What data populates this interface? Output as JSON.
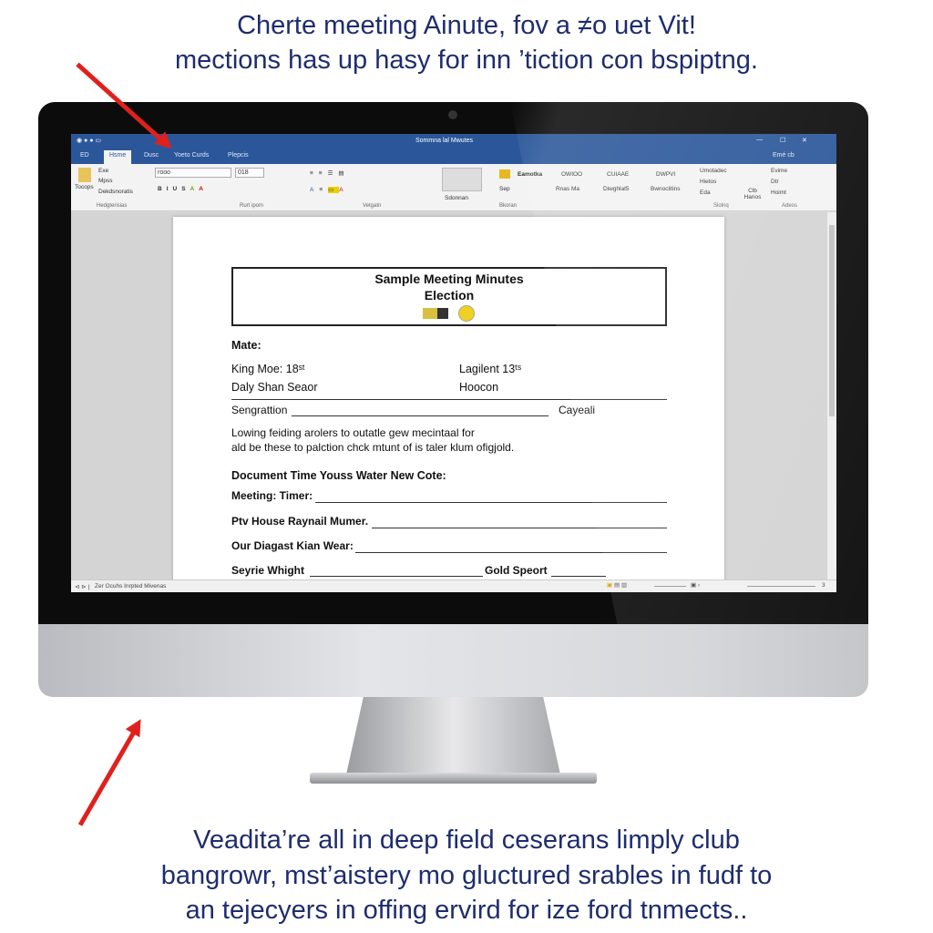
{
  "captions": {
    "top": [
      "Cherte meeting Ainute, fov a ≠o uet Vit!",
      "mections has up hasy for inn ’tiction con bspiptng."
    ],
    "bottom": [
      "Veadita’re all in deep field ceserans limply club",
      "bangrowr, mst’aistery mo gluctured srables in fudf to",
      "an tejecyers in offing ervird for ize ford tnmects.."
    ]
  },
  "accent_color": "#2b579a",
  "arrow_color": "#e0201c",
  "word": {
    "window_title": "Sommna lal Mwutes",
    "window_controls": [
      "—",
      "☐",
      "✕"
    ],
    "user": "Emé cb",
    "tabs": [
      {
        "label": "ED",
        "active": false
      },
      {
        "label": "Hsme",
        "active": true
      },
      {
        "label": "Dusc",
        "active": false
      },
      {
        "label": "Yoeto Curds",
        "active": false
      },
      {
        "label": "Plepcis",
        "active": false
      }
    ],
    "ribbon": {
      "clipboard": {
        "paste": "Tocops",
        "items": [
          "Exe",
          "Mpss",
          "Dekdsnoratis"
        ],
        "label": "Hedgterisias"
      },
      "font": {
        "font_name": "rooo",
        "font_size": "018",
        "label": "Rurt ipom"
      },
      "paragraph": {
        "label": "Vetgatn"
      },
      "styles": {
        "items": [
          "Eamotka",
          "OWIOO",
          "CUIAAE",
          "DWPVI"
        ],
        "subitems": [
          "Sep",
          "Rnas Ma",
          "Diwghlat5",
          "Bwnoclitins"
        ],
        "label": "Bkoran",
        "gallery_caption": "Sdonnan"
      },
      "editing": {
        "items": [
          "Umotadec",
          "Hietos",
          "Eda"
        ],
        "label": "Slolnq"
      },
      "large_button": "Clb Hanos",
      "right": {
        "items": [
          "Evime",
          "Dtr",
          "Hoimt"
        ],
        "label": "Adeos"
      }
    },
    "document": {
      "title": "Sample Meeting Minutes",
      "subtitle": "Election",
      "rows": {
        "mate": "Mate:",
        "king": "King Moe: 18ˢᵗ",
        "lagilent": "Lagilent 13ᵗˢ",
        "daly": "Daly Shan Seaor",
        "hoocon": "Hoocon",
        "sengrattion": "Sengrattion",
        "cayeali": "Cayeali",
        "para1": "Lowing feiding arolers to outatle gew mecintaal for",
        "para2": "ald be these to palction chck mtunt of is taler klum ofigjold.",
        "doc_time": "Document Time Youss Water New Cote:",
        "meeting_timer": "Meeting: Timer:",
        "ptv_house": "Ptv House Raynail Mumer.",
        "our_diagast": "Our Diagast Kian Wear:",
        "seyrie": "Seyrie Whight",
        "gold": "Gold Speort"
      }
    },
    "status_bar": {
      "left": "Zer Ocuhs Inrpted Mivenas",
      "zoom_icon": "3"
    }
  }
}
